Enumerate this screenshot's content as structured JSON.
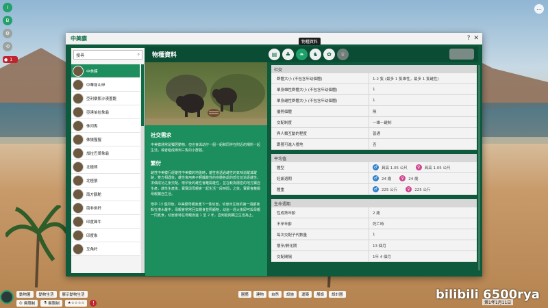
{
  "window": {
    "title": "中美貘",
    "tooltip": "物種資料",
    "section_title": "物種資料",
    "help": "?",
    "close": "✕"
  },
  "search": {
    "placeholder": "搜尋"
  },
  "species_list": [
    {
      "name": "中美貘",
      "active": true
    },
    {
      "name": "中華穿山甲",
      "active": false
    },
    {
      "name": "亞利桑那沙漠蓋龍",
      "active": false
    },
    {
      "name": "亞達伯拉象龜",
      "active": false
    },
    {
      "name": "侏河馬",
      "active": false
    },
    {
      "name": "侏狨猩猩",
      "active": false
    },
    {
      "name": "加拉巴哥象龜",
      "active": false
    },
    {
      "name": "北極熊",
      "active": false
    },
    {
      "name": "北極狼",
      "active": false
    },
    {
      "name": "南方鶴駝",
      "active": false
    },
    {
      "name": "南非劍羚",
      "active": false
    },
    {
      "name": "印度犀牛",
      "active": false
    },
    {
      "name": "印度象",
      "active": false
    },
    {
      "name": "叉角羚",
      "active": false
    }
  ],
  "tabs": [
    {
      "icon": "book-icon"
    },
    {
      "icon": "habitat-icon"
    },
    {
      "icon": "species-icon"
    },
    {
      "icon": "animal-icon"
    },
    {
      "icon": "paw-icon"
    },
    {
      "icon": "trophy-icon"
    }
  ],
  "social": {
    "heading": "社交需求",
    "text": "中美貘通常是獨居動物，但也會與幼仔一個一組和同伴在附近的場所一起生活，或者組成兩到三隻的小群體。"
  },
  "breeding": {
    "heading": "繁衍",
    "text1": "雌性中美貘行經雄性中美貘的地盤時，雄性會透過雌性的氣味追蹤其蹤跡，雙方相遇後，雄性會用鼻子輕觸雌性的身體各處的部位並追逐雌性，求偶成功之後交配。懷孕後的雌性會離開雄性，並在較為隱密的地方獨自生產，雌性生產後，寶寶與母親會一起生活一段時間，之後，寶寶會離開母親獨自生活。",
    "text2": "懷孕 13 個月後，中美貘母親會產下一隻幼崽，幼崽出生後的第一週都會躲在灌木叢中，母親會常常回去餵食並照顧牠，幼崽一週大後即可與母親一同覓食，幼崽會待在母親身邊 1 至 2 年，直到能夠獨立生活為止。"
  },
  "groups": [
    {
      "title": "社交",
      "rows": [
        {
          "k": "群體大小 (不包含年幼個體)",
          "v": "1-2 隻 (最多 1 隻雄性，最多 1 隻雌性)"
        },
        {
          "k": "單身雄性群體大小 (不包含年幼個體)",
          "v": "1"
        },
        {
          "k": "單身雌性群體大小 (不包含年幼個體)",
          "v": "1"
        },
        {
          "k": "優勢個體",
          "v": "無"
        },
        {
          "k": "交配制度",
          "v": "一雄一雌制"
        },
        {
          "k": "與人類互動的程度",
          "v": "普通"
        },
        {
          "k": "跟著可進入禮地",
          "v": "否"
        }
      ]
    },
    {
      "title": "平均值",
      "rows": [
        {
          "k": "體型",
          "male": "具高 1.05 公尺",
          "female": "具高 1.05 公尺"
        },
        {
          "k": "妊娠週期",
          "male": "24 歲",
          "female": "24 歲"
        },
        {
          "k": "體重",
          "male": "225 公斤",
          "female": "225 公斤"
        }
      ]
    },
    {
      "title": "生命週期",
      "rows": [
        {
          "k": "性成熟年齡",
          "v": "2 歲"
        },
        {
          "k": "不孕年齡",
          "v": "死亡時"
        },
        {
          "k": "每次交配子代數量",
          "v": "1"
        },
        {
          "k": "懷孕/孵化期",
          "v": "13 個月"
        },
        {
          "k": "交配間隔",
          "v": "1年 4 個月"
        }
      ]
    }
  ],
  "bottom": {
    "row1": [
      "動物園",
      "動物生活",
      "展示動物生活"
    ],
    "row2": [
      "無限制",
      "無限制"
    ],
    "toolbar": [
      "園藝",
      "建物",
      "自然",
      "設施",
      "運築",
      "展設",
      "設計圖"
    ],
    "date": "第1年1月11日",
    "warning_count": "1"
  },
  "colors": {
    "accent": "#1d8e5d",
    "dark": "#0a4d34",
    "male": "#2e7fc9",
    "female": "#d0438f"
  },
  "watermark": "bilibili 6500rya"
}
